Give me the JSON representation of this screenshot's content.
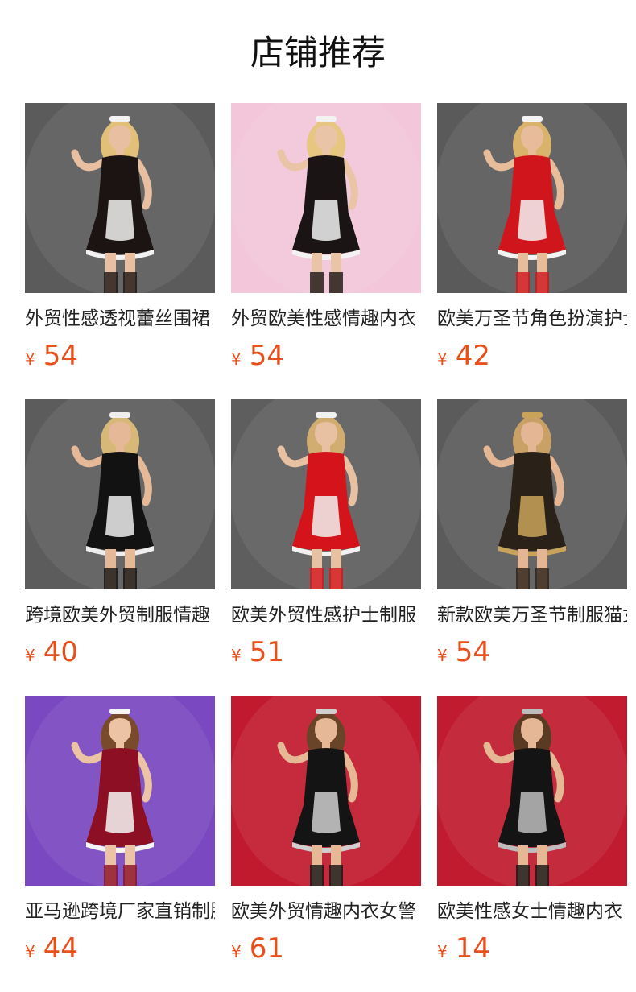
{
  "title": "店铺推荐",
  "colors": {
    "price": "#e8501b",
    "text": "#222222"
  },
  "products": [
    {
      "name": "外贸性感透视蕾丝围裙",
      "currency": "¥",
      "price": "54",
      "bg": "#5b5b5b",
      "outfit": "#1b1413",
      "trim": "#f2f2f2",
      "skin": "#e8bfa0",
      "hair": "#e2c07a"
    },
    {
      "name": "外贸欧美性感情趣内衣",
      "currency": "¥",
      "price": "54",
      "bg": "#f3c6da",
      "outfit": "#1a1414",
      "trim": "#f2f2f2",
      "skin": "#eac4a6",
      "hair": "#e7c682"
    },
    {
      "name": "欧美万圣节角色扮演护士",
      "currency": "¥",
      "price": "42",
      "bg": "#5a5a5a",
      "outfit": "#d0151c",
      "trim": "#f3f3f3",
      "skin": "#e7bc9b",
      "hair": "#d9b26b"
    },
    {
      "name": "跨境欧美外贸制服情趣",
      "currency": "¥",
      "price": "40",
      "bg": "#5c5c5c",
      "outfit": "#121212",
      "trim": "#eeeeee",
      "skin": "#e5b998",
      "hair": "#d8b878"
    },
    {
      "name": "欧美外贸性感护士制服",
      "currency": "¥",
      "price": "51",
      "bg": "#5e5e5e",
      "outfit": "#d4141a",
      "trim": "#f1f1f1",
      "skin": "#e8c0a2",
      "hair": "#d1ad72"
    },
    {
      "name": "新款欧美万圣节制服猫女",
      "currency": "¥",
      "price": "54",
      "bg": "#5b5b5b",
      "outfit": "#2a2218",
      "trim": "#c9a35a",
      "skin": "#e4b693",
      "hair": "#c9a066"
    },
    {
      "name": "亚马逊跨境厂家直销制服",
      "currency": "¥",
      "price": "44",
      "bg": "#7a48c0",
      "outfit": "#8c0f23",
      "trim": "#f6f6f6",
      "skin": "#ecc3a5",
      "hair": "#7a4a2c"
    },
    {
      "name": "欧美外贸情趣内衣女警",
      "currency": "¥",
      "price": "61",
      "bg": "#c11a2f",
      "outfit": "#141414",
      "trim": "#cfcfcf",
      "skin": "#e6b896",
      "hair": "#6a4428"
    },
    {
      "name": "欧美性感女士情趣内衣",
      "currency": "¥",
      "price": "14",
      "bg": "#c01b2e",
      "outfit": "#141414",
      "trim": "#bdbdbd",
      "skin": "#e5b794",
      "hair": "#5a3a22"
    }
  ]
}
